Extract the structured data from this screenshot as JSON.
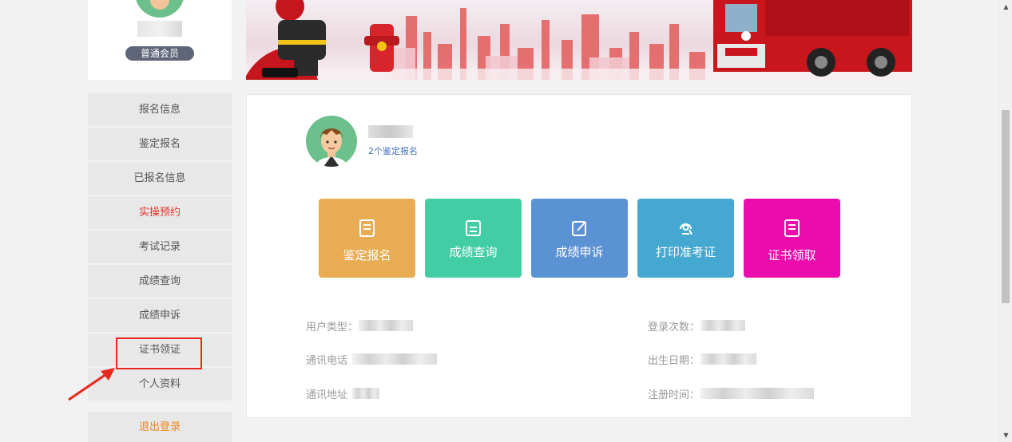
{
  "profile": {
    "badge": "普通会员"
  },
  "sidebar": {
    "items": [
      {
        "label": "报名信息"
      },
      {
        "label": "鉴定报名"
      },
      {
        "label": "已报名信息"
      },
      {
        "label": "实操预约"
      },
      {
        "label": "考试记录"
      },
      {
        "label": "成绩查询"
      },
      {
        "label": "成绩申诉"
      },
      {
        "label": "证书领证"
      },
      {
        "label": "个人资料"
      }
    ],
    "logout": "退出登录"
  },
  "user": {
    "subtitle": "2个鉴定报名"
  },
  "tiles": [
    {
      "label": "鉴定报名",
      "icon": "document-icon",
      "color": "#e8ad52"
    },
    {
      "label": "成绩查询",
      "icon": "list-icon",
      "color": "#43cda4"
    },
    {
      "label": "成绩申诉",
      "icon": "edit-icon",
      "color": "#5b92d3"
    },
    {
      "label": "打印准考证",
      "icon": "print-icon",
      "color": "#44a8d0"
    },
    {
      "label": "证书领取",
      "icon": "certificate-icon",
      "color": "#ec0cae"
    }
  ],
  "info": {
    "user_type": "用户类型：",
    "login_count": "登录次数：",
    "phone": "通讯电话",
    "birthday": "出生日期：",
    "address": "通讯地址",
    "register_time": "注册时间："
  },
  "colors": {
    "active_item": "#e0352b",
    "logout": "#f08519",
    "highlight": "#e8271d",
    "badge": "#5f6579",
    "link": "#3f6fb7"
  }
}
